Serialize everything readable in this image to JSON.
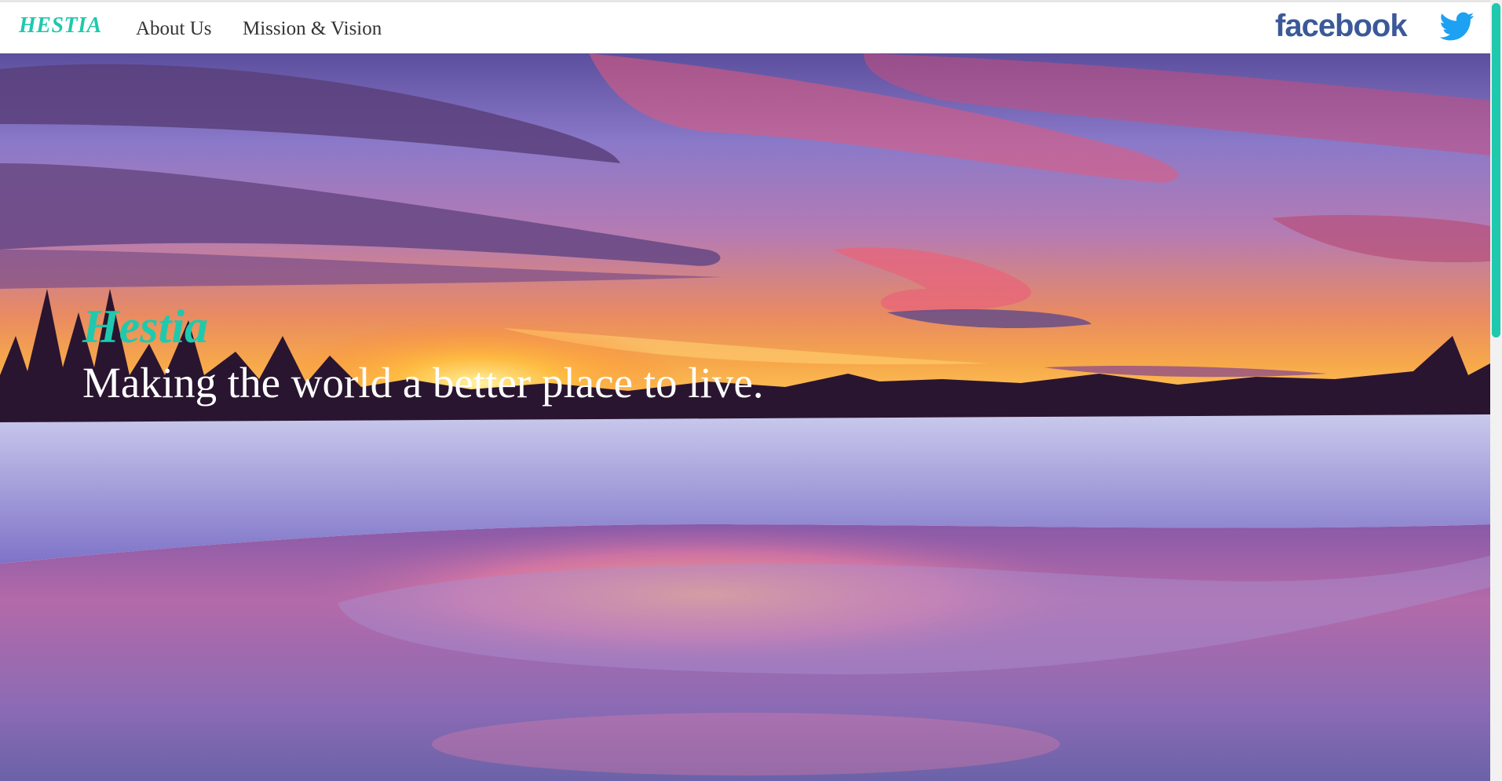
{
  "navbar": {
    "brand": "HESTIA",
    "links": [
      {
        "label": "About Us"
      },
      {
        "label": "Mission & Vision"
      }
    ],
    "social": {
      "facebook_label": "facebook",
      "twitter_icon": "twitter-bird-icon"
    }
  },
  "hero": {
    "title": "Hestia",
    "tagline": "Making the world a better place to live.",
    "background": "sunset-over-frozen-lake-image"
  },
  "colors": {
    "accent": "#1fc9ad",
    "nav_text": "#333333",
    "facebook": "#3b5998",
    "twitter": "#1da1f2",
    "tagline": "#ffffff"
  }
}
